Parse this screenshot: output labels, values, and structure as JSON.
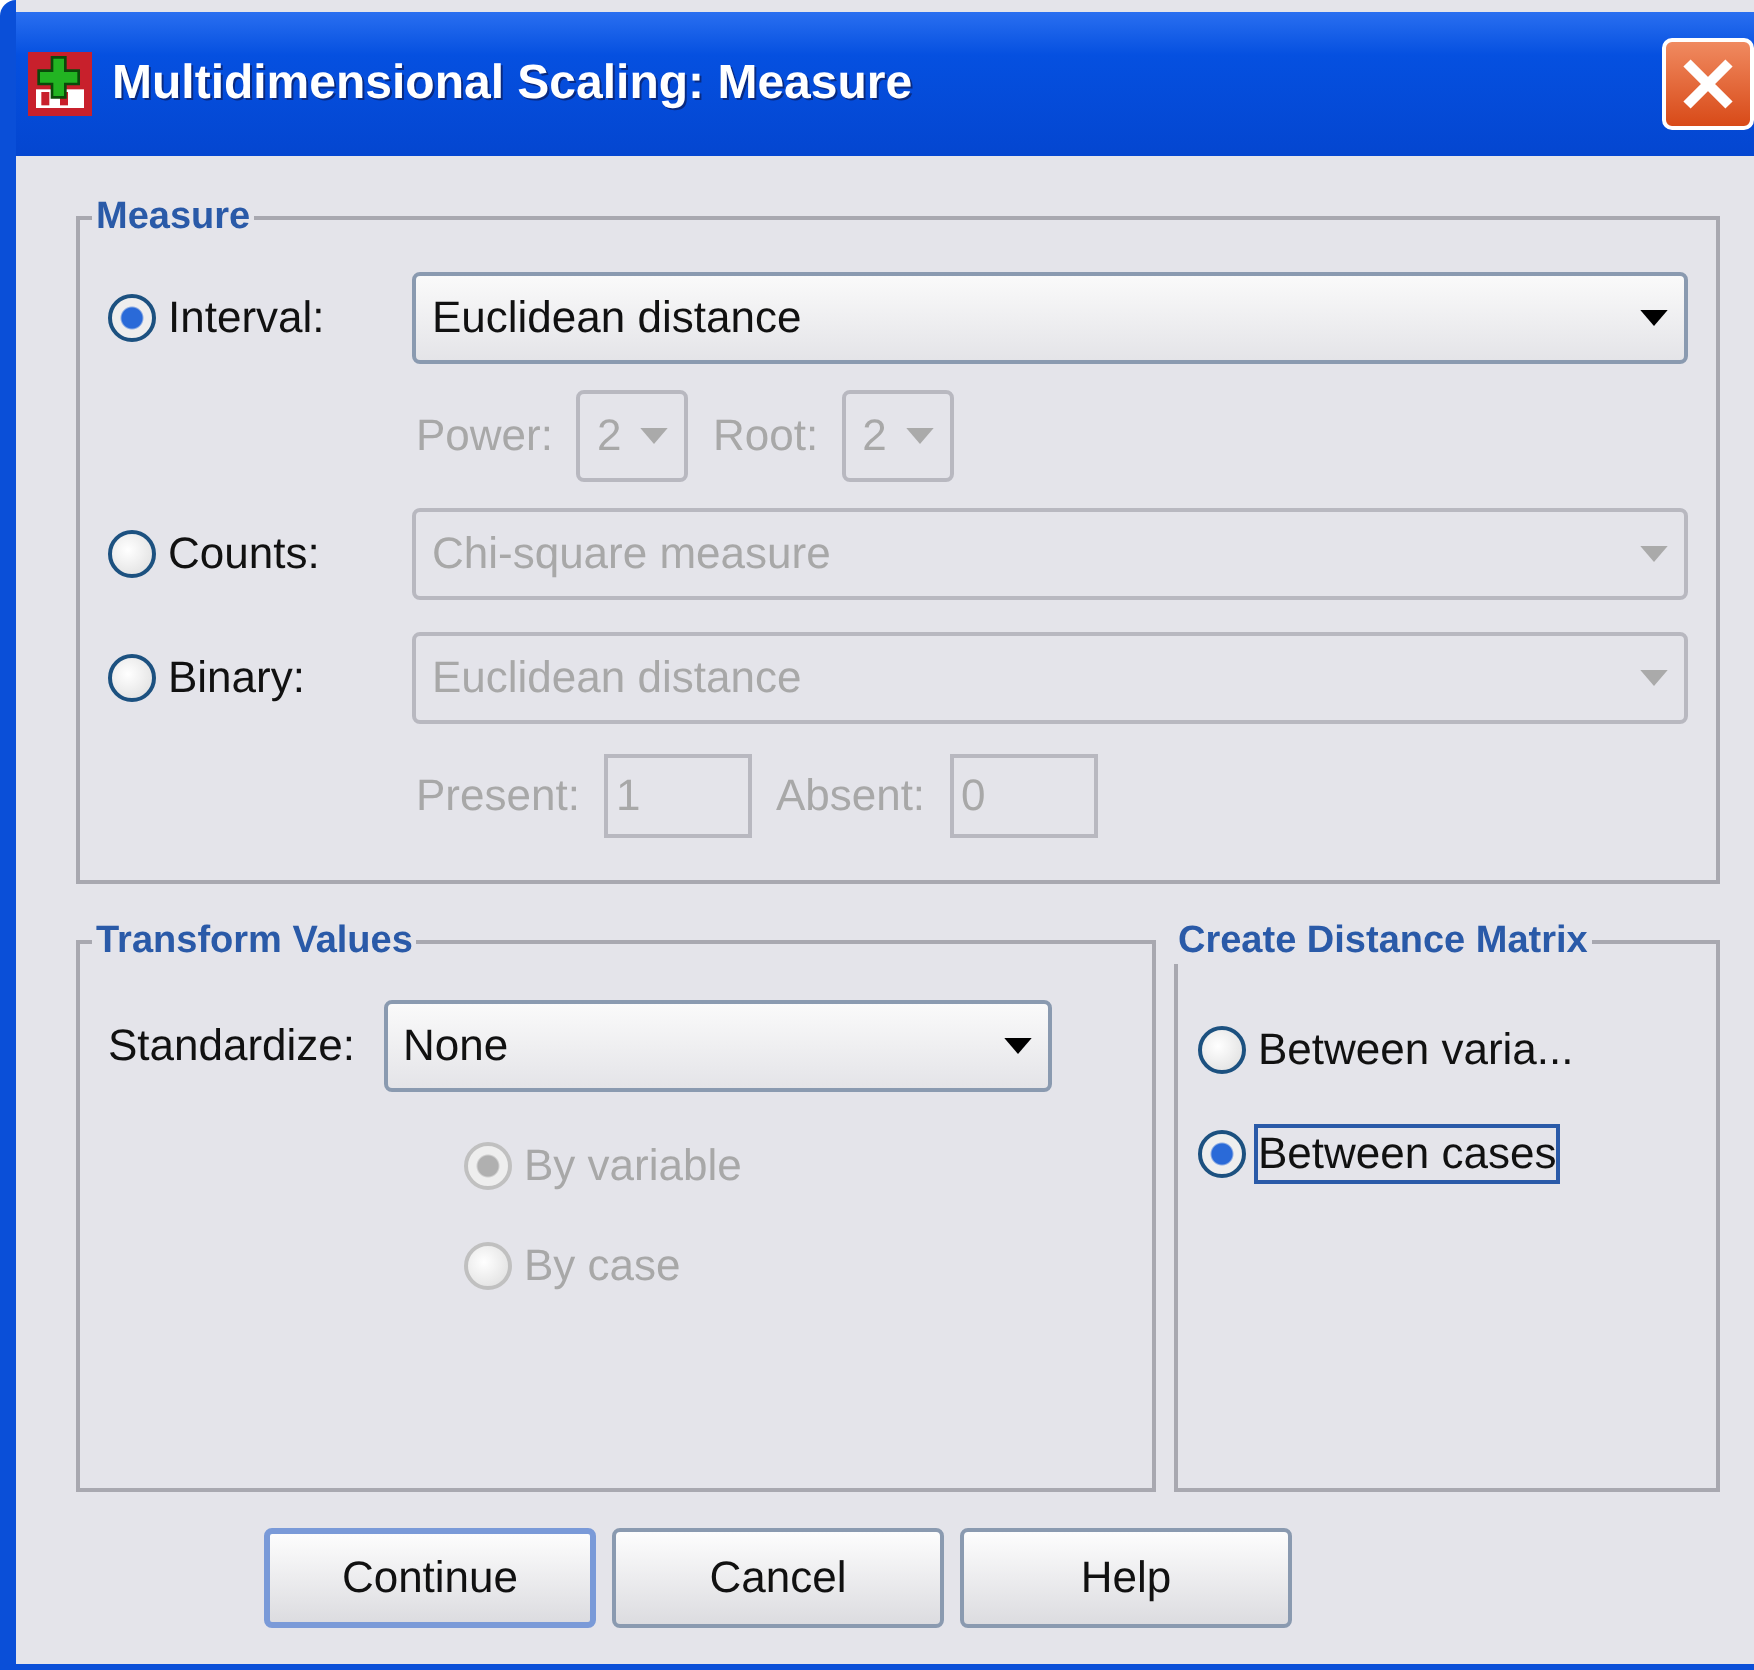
{
  "window": {
    "title": "Multidimensional Scaling: Measure"
  },
  "measure": {
    "title": "Measure",
    "options": [
      {
        "label": "Interval:",
        "selected": true,
        "dropdown": {
          "value": "Euclidean distance",
          "disabled": false
        }
      },
      {
        "label": "Counts:",
        "selected": false,
        "dropdown": {
          "value": "Chi-square measure",
          "disabled": true
        }
      },
      {
        "label": "Binary:",
        "selected": false,
        "dropdown": {
          "value": "Euclidean distance",
          "disabled": true
        }
      }
    ],
    "interval_params": [
      {
        "kind": "combo",
        "label": "Power:",
        "value": "2",
        "disabled": true
      },
      {
        "kind": "combo",
        "label": "Root:",
        "value": "2",
        "disabled": true
      }
    ],
    "binary_params": [
      {
        "kind": "field",
        "label": "Present:",
        "value": "1",
        "disabled": true
      },
      {
        "kind": "field",
        "label": "Absent:",
        "value": "0",
        "disabled": true
      }
    ]
  },
  "transform": {
    "title": "Transform Values",
    "standardize": {
      "label": "Standardize:",
      "value": "None",
      "disabled": false
    },
    "options": [
      {
        "label": "By variable",
        "selected": true,
        "disabled": true
      },
      {
        "label": "By case",
        "selected": false,
        "disabled": true
      }
    ]
  },
  "distance_matrix": {
    "title": "Create Distance Matrix",
    "options": [
      {
        "label": "Between varia...",
        "selected": false,
        "focused": false
      },
      {
        "label": "Between cases",
        "selected": true,
        "focused": true
      }
    ]
  },
  "buttons": [
    {
      "label": "Continue",
      "default": true
    },
    {
      "label": "Cancel",
      "default": false
    },
    {
      "label": "Help",
      "default": false
    }
  ]
}
